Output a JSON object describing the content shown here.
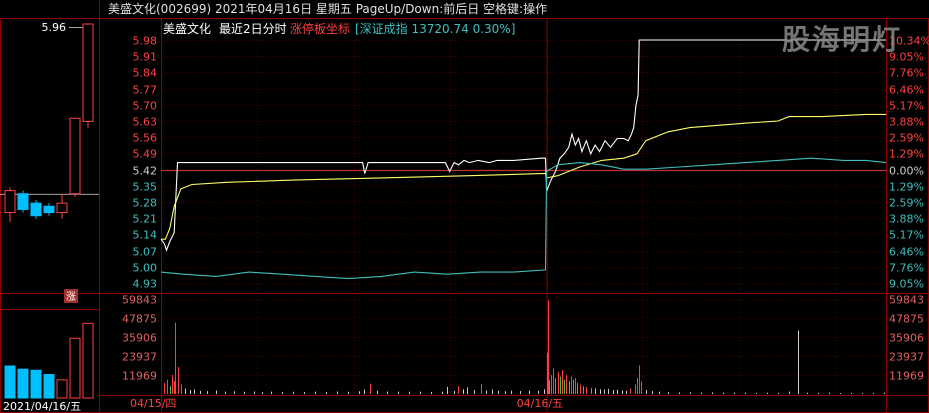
{
  "header": {
    "title": "美盛文化(002699)  2021年04月16日 星期五 PageUp/Down:前后日 空格键:操作"
  },
  "legend": {
    "stock_name": "美盛文化",
    "period": "最近2日分时",
    "limit_label": "涨停板坐标",
    "index_label": "[深证成指 13720.74 0.30%]"
  },
  "watermark": "股海明灯",
  "left_panel": {
    "price_label": "5.96",
    "date_label": "2021/04/16/五",
    "badge": "涨"
  },
  "colors": {
    "background": "#000000",
    "grid": "#8b0000",
    "price_line": "#ffffff",
    "avg_line": "#ffff66",
    "index_line": "#3fbfbf",
    "up": "#ff4040",
    "down": "#00bfff",
    "flat": "#cccccc"
  },
  "chart_data": {
    "type": "line",
    "prev_close": 5.42,
    "ylim": [
      4.87,
      5.98
    ],
    "price_ticks": [
      "5.98",
      "5.91",
      "5.84",
      "5.77",
      "5.70",
      "5.63",
      "5.56",
      "5.49",
      "5.42",
      "5.35",
      "5.28",
      "5.21",
      "5.14",
      "5.07",
      "5.00",
      "4.93"
    ],
    "pct_ticks": [
      "10.34%",
      "9.05%",
      "7.76%",
      "6.46%",
      "5.17%",
      "3.88%",
      "2.59%",
      "1.29%",
      "0.00%",
      "1.29%",
      "2.59%",
      "3.88%",
      "5.17%",
      "6.46%",
      "7.76%",
      "9.05%"
    ],
    "volume_ticks": [
      "59843",
      "47875",
      "35906",
      "23937",
      "11969"
    ],
    "volume_max": 59843,
    "x_labels": [
      "04/15/四",
      "04/16/五"
    ],
    "series": [
      {
        "name": "价格",
        "key": "price",
        "points": [
          [
            0,
            5.07
          ],
          [
            3,
            5.05
          ],
          [
            5,
            5.02
          ],
          [
            8,
            5.06
          ],
          [
            12,
            5.1
          ],
          [
            15,
            5.42
          ],
          [
            30,
            5.42
          ],
          [
            60,
            5.42
          ],
          [
            100,
            5.42
          ],
          [
            150,
            5.42
          ],
          [
            183,
            5.42
          ],
          [
            185,
            5.37
          ],
          [
            188,
            5.42
          ],
          [
            220,
            5.42
          ],
          [
            258,
            5.42
          ],
          [
            262,
            5.38
          ],
          [
            266,
            5.42
          ],
          [
            270,
            5.41
          ],
          [
            275,
            5.43
          ],
          [
            280,
            5.42
          ],
          [
            288,
            5.43
          ],
          [
            298,
            5.42
          ],
          [
            305,
            5.43
          ],
          [
            320,
            5.43
          ],
          [
            345,
            5.44
          ],
          [
            349,
            5.44
          ],
          [
            350,
            5.29
          ],
          [
            354,
            5.34
          ],
          [
            358,
            5.38
          ],
          [
            362,
            5.44
          ],
          [
            366,
            5.46
          ],
          [
            370,
            5.49
          ],
          [
            373,
            5.55
          ],
          [
            376,
            5.5
          ],
          [
            379,
            5.53
          ],
          [
            382,
            5.47
          ],
          [
            386,
            5.52
          ],
          [
            390,
            5.46
          ],
          [
            394,
            5.5
          ],
          [
            398,
            5.47
          ],
          [
            403,
            5.52
          ],
          [
            408,
            5.49
          ],
          [
            414,
            5.53
          ],
          [
            420,
            5.53
          ],
          [
            424,
            5.52
          ],
          [
            427,
            5.55
          ],
          [
            429,
            5.58
          ],
          [
            431,
            5.68
          ],
          [
            433,
            5.73
          ],
          [
            434,
            5.98
          ],
          [
            440,
            5.98
          ],
          [
            480,
            5.98
          ],
          [
            520,
            5.98
          ],
          [
            600,
            5.98
          ],
          [
            658,
            5.98
          ]
        ]
      },
      {
        "name": "均价",
        "key": "avg",
        "points": [
          [
            0,
            5.07
          ],
          [
            4,
            5.07
          ],
          [
            8,
            5.12
          ],
          [
            12,
            5.22
          ],
          [
            18,
            5.3
          ],
          [
            28,
            5.32
          ],
          [
            60,
            5.33
          ],
          [
            120,
            5.34
          ],
          [
            200,
            5.35
          ],
          [
            280,
            5.36
          ],
          [
            349,
            5.37
          ],
          [
            350,
            5.35
          ],
          [
            360,
            5.36
          ],
          [
            380,
            5.4
          ],
          [
            400,
            5.43
          ],
          [
            420,
            5.44
          ],
          [
            432,
            5.46
          ],
          [
            440,
            5.52
          ],
          [
            460,
            5.56
          ],
          [
            480,
            5.58
          ],
          [
            530,
            5.6
          ],
          [
            560,
            5.61
          ],
          [
            570,
            5.63
          ],
          [
            600,
            5.63
          ],
          [
            640,
            5.64
          ],
          [
            658,
            5.64
          ]
        ]
      },
      {
        "name": "深证成指",
        "key": "index",
        "points": [
          [
            0,
            4.92
          ],
          [
            20,
            4.91
          ],
          [
            50,
            4.9
          ],
          [
            80,
            4.92
          ],
          [
            110,
            4.91
          ],
          [
            140,
            4.9
          ],
          [
            170,
            4.89
          ],
          [
            200,
            4.9
          ],
          [
            230,
            4.92
          ],
          [
            260,
            4.91
          ],
          [
            290,
            4.92
          ],
          [
            320,
            4.92
          ],
          [
            349,
            4.93
          ],
          [
            350,
            5.38
          ],
          [
            360,
            5.41
          ],
          [
            380,
            5.42
          ],
          [
            400,
            5.41
          ],
          [
            420,
            5.39
          ],
          [
            440,
            5.39
          ],
          [
            470,
            5.4
          ],
          [
            500,
            5.41
          ],
          [
            530,
            5.42
          ],
          [
            560,
            5.43
          ],
          [
            590,
            5.44
          ],
          [
            620,
            5.43
          ],
          [
            640,
            5.43
          ],
          [
            658,
            5.42
          ]
        ]
      }
    ],
    "volumes": [
      {
        "t": 3,
        "v": 7000,
        "d": "up"
      },
      {
        "t": 5,
        "v": 9000,
        "d": "up"
      },
      {
        "t": 8,
        "v": 5000,
        "d": "down"
      },
      {
        "t": 10,
        "v": 12000,
        "d": "up"
      },
      {
        "t": 12,
        "v": 8000,
        "d": "up"
      },
      {
        "t": 13,
        "v": 45000,
        "d": "up"
      },
      {
        "t": 15,
        "v": 17000,
        "d": "up"
      },
      {
        "t": 18,
        "v": 6000,
        "d": "up"
      },
      {
        "t": 22,
        "v": 3500,
        "d": "flat"
      },
      {
        "t": 26,
        "v": 2500,
        "d": "flat"
      },
      {
        "t": 30,
        "v": 2800,
        "d": "flat"
      },
      {
        "t": 35,
        "v": 2000,
        "d": "flat"
      },
      {
        "t": 42,
        "v": 1800,
        "d": "flat"
      },
      {
        "t": 50,
        "v": 2200,
        "d": "flat"
      },
      {
        "t": 58,
        "v": 1500,
        "d": "flat"
      },
      {
        "t": 66,
        "v": 1700,
        "d": "flat"
      },
      {
        "t": 75,
        "v": 1400,
        "d": "flat"
      },
      {
        "t": 84,
        "v": 1600,
        "d": "flat"
      },
      {
        "t": 92,
        "v": 1200,
        "d": "flat"
      },
      {
        "t": 100,
        "v": 1500,
        "d": "flat"
      },
      {
        "t": 110,
        "v": 1300,
        "d": "flat"
      },
      {
        "t": 120,
        "v": 1400,
        "d": "flat"
      },
      {
        "t": 130,
        "v": 1200,
        "d": "flat"
      },
      {
        "t": 140,
        "v": 1500,
        "d": "flat"
      },
      {
        "t": 150,
        "v": 1300,
        "d": "flat"
      },
      {
        "t": 160,
        "v": 1600,
        "d": "flat"
      },
      {
        "t": 170,
        "v": 1400,
        "d": "flat"
      },
      {
        "t": 180,
        "v": 1700,
        "d": "flat"
      },
      {
        "t": 184,
        "v": 2800,
        "d": "flat"
      },
      {
        "t": 190,
        "v": 6500,
        "d": "up"
      },
      {
        "t": 196,
        "v": 2000,
        "d": "flat"
      },
      {
        "t": 205,
        "v": 1600,
        "d": "flat"
      },
      {
        "t": 215,
        "v": 1500,
        "d": "flat"
      },
      {
        "t": 225,
        "v": 1400,
        "d": "flat"
      },
      {
        "t": 235,
        "v": 1500,
        "d": "flat"
      },
      {
        "t": 245,
        "v": 1300,
        "d": "flat"
      },
      {
        "t": 255,
        "v": 1500,
        "d": "flat"
      },
      {
        "t": 260,
        "v": 4500,
        "d": "flat"
      },
      {
        "t": 266,
        "v": 2000,
        "d": "flat"
      },
      {
        "t": 270,
        "v": 5000,
        "d": "up"
      },
      {
        "t": 274,
        "v": 3000,
        "d": "flat"
      },
      {
        "t": 278,
        "v": 4200,
        "d": "flat"
      },
      {
        "t": 284,
        "v": 2500,
        "d": "flat"
      },
      {
        "t": 290,
        "v": 6200,
        "d": "up"
      },
      {
        "t": 295,
        "v": 2200,
        "d": "flat"
      },
      {
        "t": 300,
        "v": 2800,
        "d": "flat"
      },
      {
        "t": 306,
        "v": 2000,
        "d": "flat"
      },
      {
        "t": 312,
        "v": 1800,
        "d": "flat"
      },
      {
        "t": 318,
        "v": 2100,
        "d": "flat"
      },
      {
        "t": 326,
        "v": 1900,
        "d": "flat"
      },
      {
        "t": 334,
        "v": 2200,
        "d": "flat"
      },
      {
        "t": 342,
        "v": 2000,
        "d": "flat"
      },
      {
        "t": 348,
        "v": 3000,
        "d": "flat"
      },
      {
        "t": 350,
        "v": 26000,
        "d": "up"
      },
      {
        "t": 351,
        "v": 59000,
        "d": "up"
      },
      {
        "t": 352,
        "v": 9000,
        "d": "down"
      },
      {
        "t": 354,
        "v": 12000,
        "d": "up"
      },
      {
        "t": 356,
        "v": 16000,
        "d": "up"
      },
      {
        "t": 358,
        "v": 10000,
        "d": "down"
      },
      {
        "t": 360,
        "v": 14000,
        "d": "up"
      },
      {
        "t": 362,
        "v": 11000,
        "d": "down"
      },
      {
        "t": 364,
        "v": 15000,
        "d": "up"
      },
      {
        "t": 366,
        "v": 9000,
        "d": "down"
      },
      {
        "t": 368,
        "v": 12000,
        "d": "up"
      },
      {
        "t": 370,
        "v": 8000,
        "d": "down"
      },
      {
        "t": 372,
        "v": 11000,
        "d": "up"
      },
      {
        "t": 374,
        "v": 9000,
        "d": "down"
      },
      {
        "t": 376,
        "v": 10000,
        "d": "up"
      },
      {
        "t": 378,
        "v": 7000,
        "d": "down"
      },
      {
        "t": 380,
        "v": 6000,
        "d": "up"
      },
      {
        "t": 383,
        "v": 5000,
        "d": "down"
      },
      {
        "t": 386,
        "v": 4500,
        "d": "up"
      },
      {
        "t": 390,
        "v": 3800,
        "d": "down"
      },
      {
        "t": 394,
        "v": 3500,
        "d": "flat"
      },
      {
        "t": 398,
        "v": 3000,
        "d": "flat"
      },
      {
        "t": 402,
        "v": 2800,
        "d": "flat"
      },
      {
        "t": 406,
        "v": 3200,
        "d": "flat"
      },
      {
        "t": 410,
        "v": 2500,
        "d": "flat"
      },
      {
        "t": 414,
        "v": 2600,
        "d": "flat"
      },
      {
        "t": 418,
        "v": 2200,
        "d": "flat"
      },
      {
        "t": 422,
        "v": 2000,
        "d": "flat"
      },
      {
        "t": 426,
        "v": 3500,
        "d": "up"
      },
      {
        "t": 430,
        "v": 6000,
        "d": "up"
      },
      {
        "t": 432,
        "v": 10000,
        "d": "up"
      },
      {
        "t": 434,
        "v": 18000,
        "d": "up"
      },
      {
        "t": 436,
        "v": 8000,
        "d": "up"
      },
      {
        "t": 440,
        "v": 2500,
        "d": "flat"
      },
      {
        "t": 446,
        "v": 1800,
        "d": "flat"
      },
      {
        "t": 452,
        "v": 1500,
        "d": "flat"
      },
      {
        "t": 460,
        "v": 1200,
        "d": "flat"
      },
      {
        "t": 470,
        "v": 1000,
        "d": "flat"
      },
      {
        "t": 480,
        "v": 1100,
        "d": "flat"
      },
      {
        "t": 490,
        "v": 900,
        "d": "flat"
      },
      {
        "t": 500,
        "v": 1000,
        "d": "flat"
      },
      {
        "t": 510,
        "v": 800,
        "d": "flat"
      },
      {
        "t": 520,
        "v": 900,
        "d": "flat"
      },
      {
        "t": 530,
        "v": 800,
        "d": "flat"
      },
      {
        "t": 540,
        "v": 700,
        "d": "flat"
      },
      {
        "t": 550,
        "v": 800,
        "d": "flat"
      },
      {
        "t": 560,
        "v": 700,
        "d": "flat"
      },
      {
        "t": 570,
        "v": 1500,
        "d": "flat"
      },
      {
        "t": 578,
        "v": 40000,
        "d": "flat"
      },
      {
        "t": 586,
        "v": 800,
        "d": "flat"
      },
      {
        "t": 596,
        "v": 700,
        "d": "flat"
      },
      {
        "t": 606,
        "v": 800,
        "d": "flat"
      },
      {
        "t": 616,
        "v": 600,
        "d": "flat"
      },
      {
        "t": 626,
        "v": 700,
        "d": "flat"
      },
      {
        "t": 636,
        "v": 600,
        "d": "flat"
      },
      {
        "t": 646,
        "v": 700,
        "d": "flat"
      },
      {
        "t": 656,
        "v": 900,
        "d": "flat"
      }
    ],
    "mini_candles": [
      {
        "o": 5.43,
        "c": 5.36,
        "h": 5.44,
        "l": 5.33,
        "dir": "up"
      },
      {
        "o": 5.42,
        "c": 5.37,
        "h": 5.43,
        "l": 5.36,
        "dir": "down"
      },
      {
        "o": 5.39,
        "c": 5.35,
        "h": 5.4,
        "l": 5.34,
        "dir": "down"
      },
      {
        "o": 5.38,
        "c": 5.36,
        "h": 5.39,
        "l": 5.35,
        "dir": "down"
      },
      {
        "o": 5.36,
        "c": 5.39,
        "h": 5.42,
        "l": 5.34,
        "dir": "up"
      },
      {
        "o": 5.42,
        "c": 5.66,
        "h": 5.66,
        "l": 5.41,
        "dir": "up"
      },
      {
        "o": 5.65,
        "c": 5.96,
        "h": 5.96,
        "l": 5.63,
        "dir": "up"
      }
    ],
    "mini_volumes": [
      {
        "v": 30000,
        "dir": "down"
      },
      {
        "v": 27000,
        "dir": "down"
      },
      {
        "v": 26000,
        "dir": "down"
      },
      {
        "v": 22000,
        "dir": "down"
      },
      {
        "v": 17000,
        "dir": "up"
      },
      {
        "v": 56000,
        "dir": "up"
      },
      {
        "v": 70000,
        "dir": "up"
      }
    ]
  }
}
